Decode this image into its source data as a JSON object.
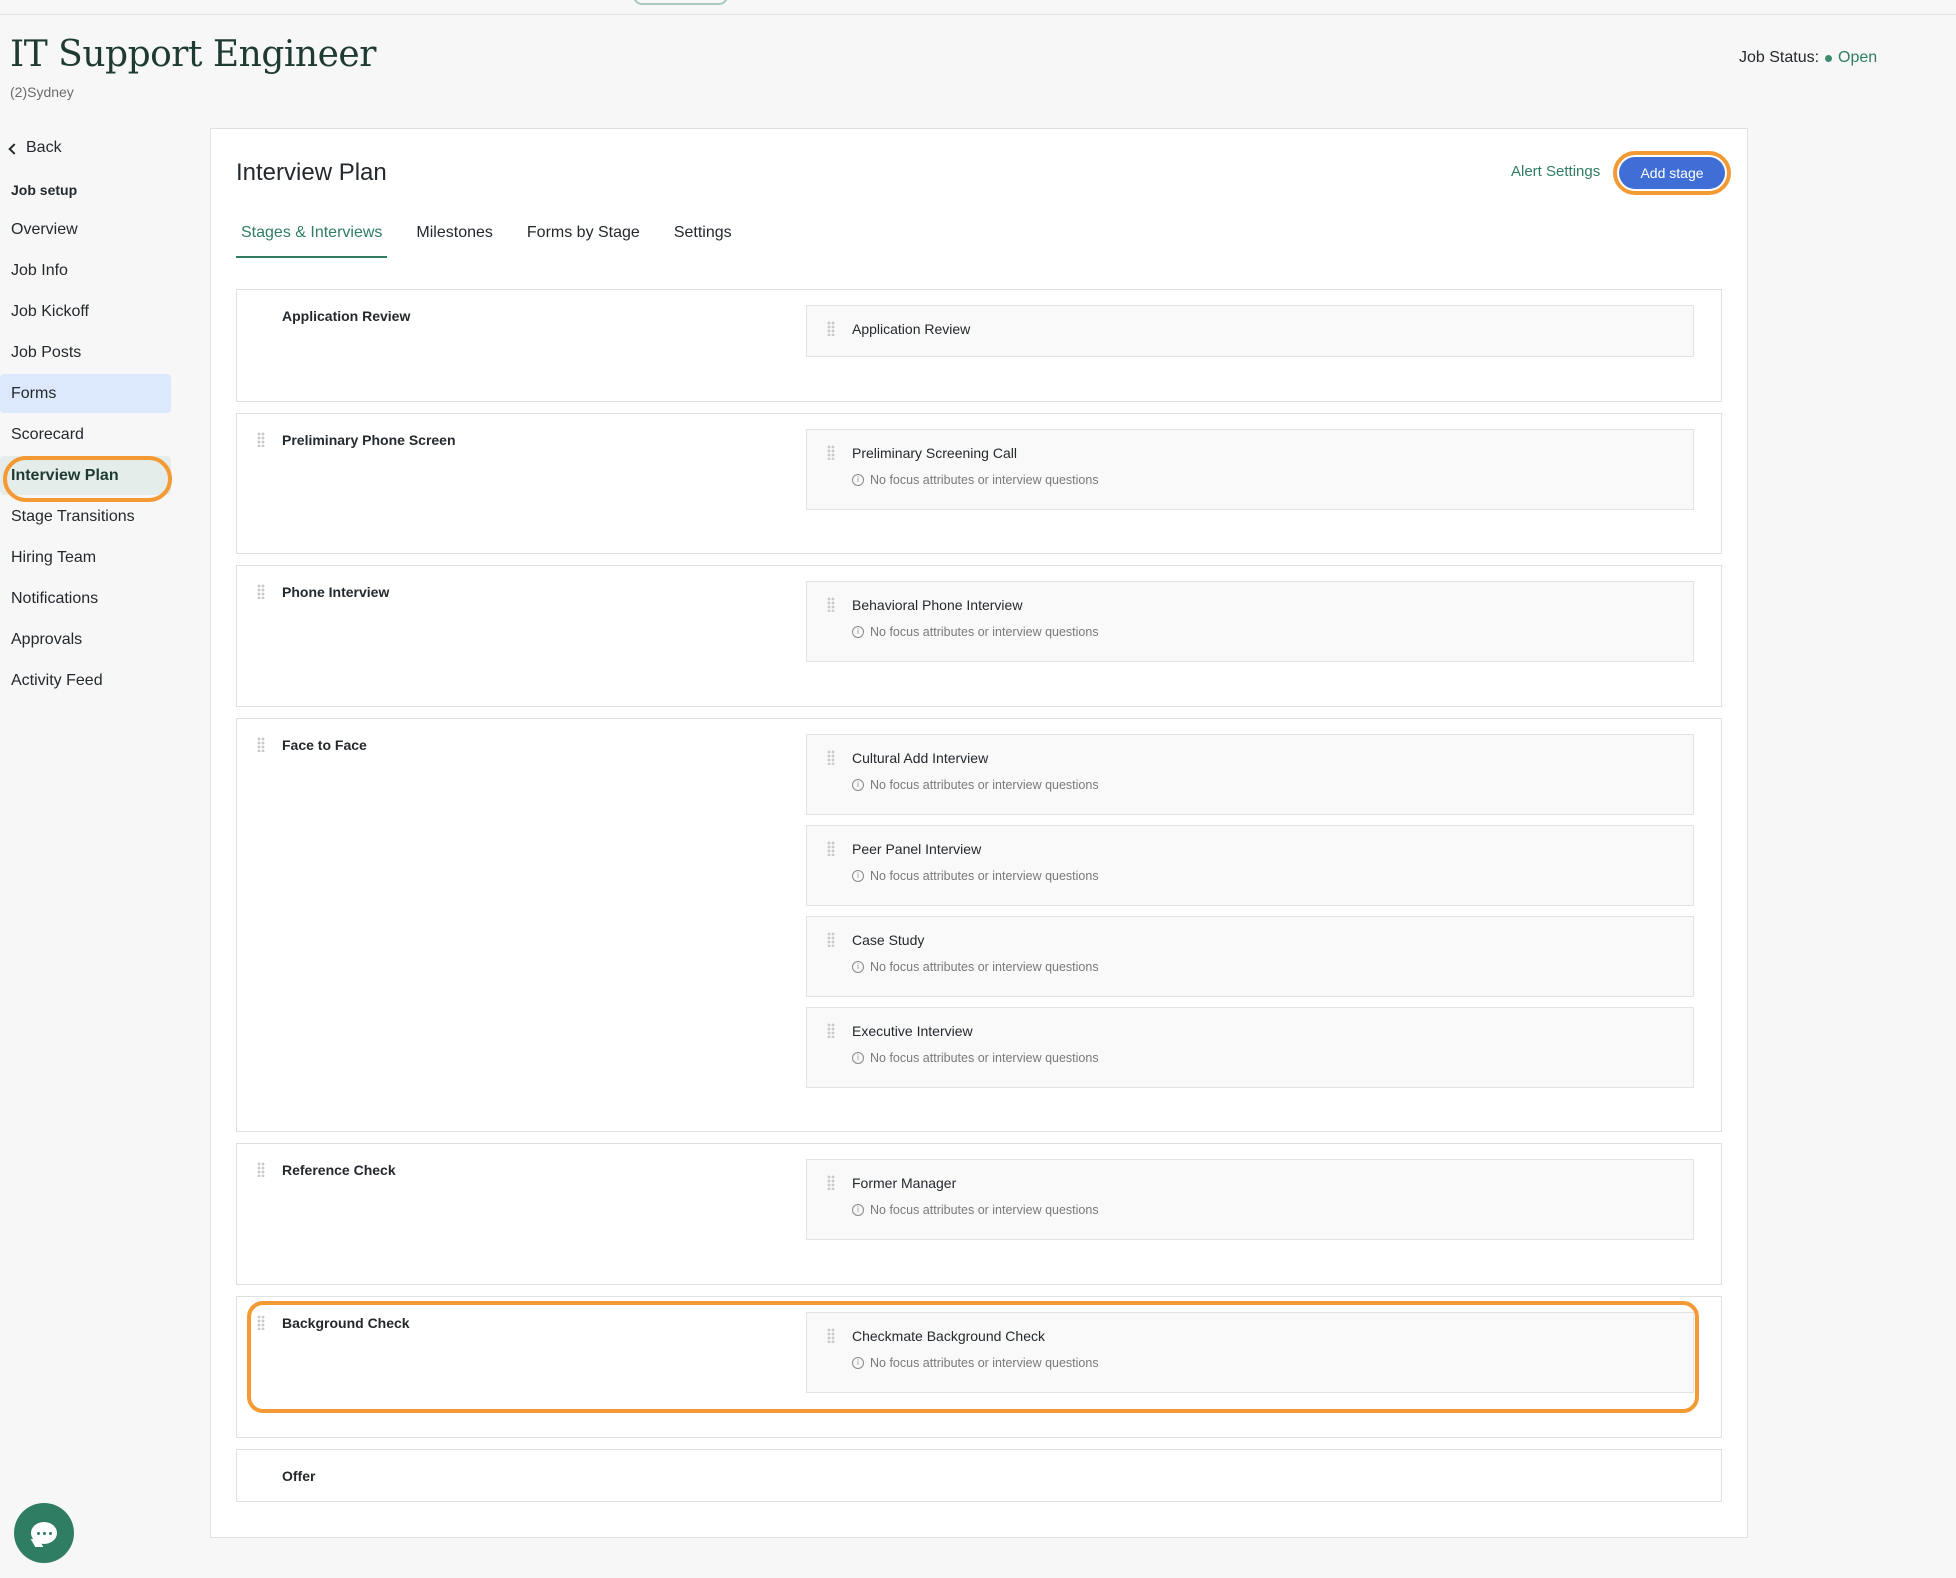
{
  "header": {
    "job_title": "IT Support Engineer",
    "location": "(2)Sydney",
    "status_label": "Job Status:",
    "status_value": "Open"
  },
  "sidebar": {
    "back_label": "Back",
    "section_label": "Job setup",
    "items": [
      {
        "label": "Overview"
      },
      {
        "label": "Job Info"
      },
      {
        "label": "Job Kickoff"
      },
      {
        "label": "Job Posts"
      },
      {
        "label": "Forms"
      },
      {
        "label": "Scorecard"
      },
      {
        "label": "Interview Plan"
      },
      {
        "label": "Stage Transitions"
      },
      {
        "label": "Hiring Team"
      },
      {
        "label": "Notifications"
      },
      {
        "label": "Approvals"
      },
      {
        "label": "Activity Feed"
      }
    ]
  },
  "panel": {
    "title": "Interview Plan",
    "alert_settings": "Alert Settings",
    "add_stage": "Add stage",
    "tabs": [
      {
        "label": "Stages & Interviews"
      },
      {
        "label": "Milestones"
      },
      {
        "label": "Forms by Stage"
      },
      {
        "label": "Settings"
      }
    ]
  },
  "note_text": "No focus attributes or interview questions",
  "stages": [
    {
      "name": "Application Review",
      "interviews": [
        {
          "name": "Application Review"
        }
      ]
    },
    {
      "name": "Preliminary Phone Screen",
      "interviews": [
        {
          "name": "Preliminary Screening Call"
        }
      ]
    },
    {
      "name": "Phone Interview",
      "interviews": [
        {
          "name": "Behavioral Phone Interview"
        }
      ]
    },
    {
      "name": "Face to Face",
      "interviews": [
        {
          "name": "Cultural Add Interview"
        },
        {
          "name": "Peer Panel Interview"
        },
        {
          "name": "Case Study"
        },
        {
          "name": "Executive Interview"
        }
      ]
    },
    {
      "name": "Reference Check",
      "interviews": [
        {
          "name": "Former Manager"
        }
      ]
    },
    {
      "name": "Background Check",
      "interviews": [
        {
          "name": "Checkmate Background Check"
        }
      ]
    },
    {
      "name": "Offer",
      "interviews": []
    }
  ],
  "colors": {
    "accent_green": "#2f7d63",
    "primary_blue": "#3f6fd6",
    "highlight_orange": "#f39a34"
  }
}
